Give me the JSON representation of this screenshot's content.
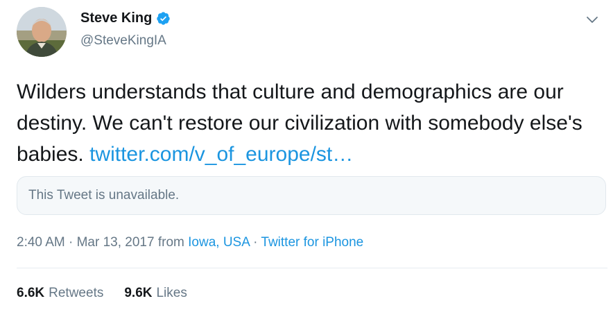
{
  "author": {
    "display_name": "Steve King",
    "handle": "@SteveKingIA",
    "verified": true,
    "avatar_icon": "profile-photo",
    "verified_icon": "verified-badge-icon"
  },
  "menu_icon": "chevron-down-icon",
  "tweet": {
    "text": "Wilders understands that culture and demographics are our destiny. We can't restore our civilization with somebody else's babies.",
    "link_text": "twitter.com/v_of_europe/st…"
  },
  "quoted_tweet": {
    "text": "This Tweet is unavailable."
  },
  "meta": {
    "time": "2:40 AM",
    "sep1": "·",
    "date": "Mar 13, 2017",
    "from_word": "from",
    "location": "Iowa, USA",
    "sep2": "·",
    "source": "Twitter for iPhone"
  },
  "stats": {
    "retweets_count": "6.6K",
    "retweets_label": "Retweets",
    "likes_count": "9.6K",
    "likes_label": "Likes"
  },
  "colors": {
    "link": "#1b95e0",
    "secondary_text": "#657786",
    "primary_text": "#14171a",
    "verified": "#1da1f2",
    "quote_bg": "#f5f8fa",
    "border": "#e1e8ed"
  }
}
